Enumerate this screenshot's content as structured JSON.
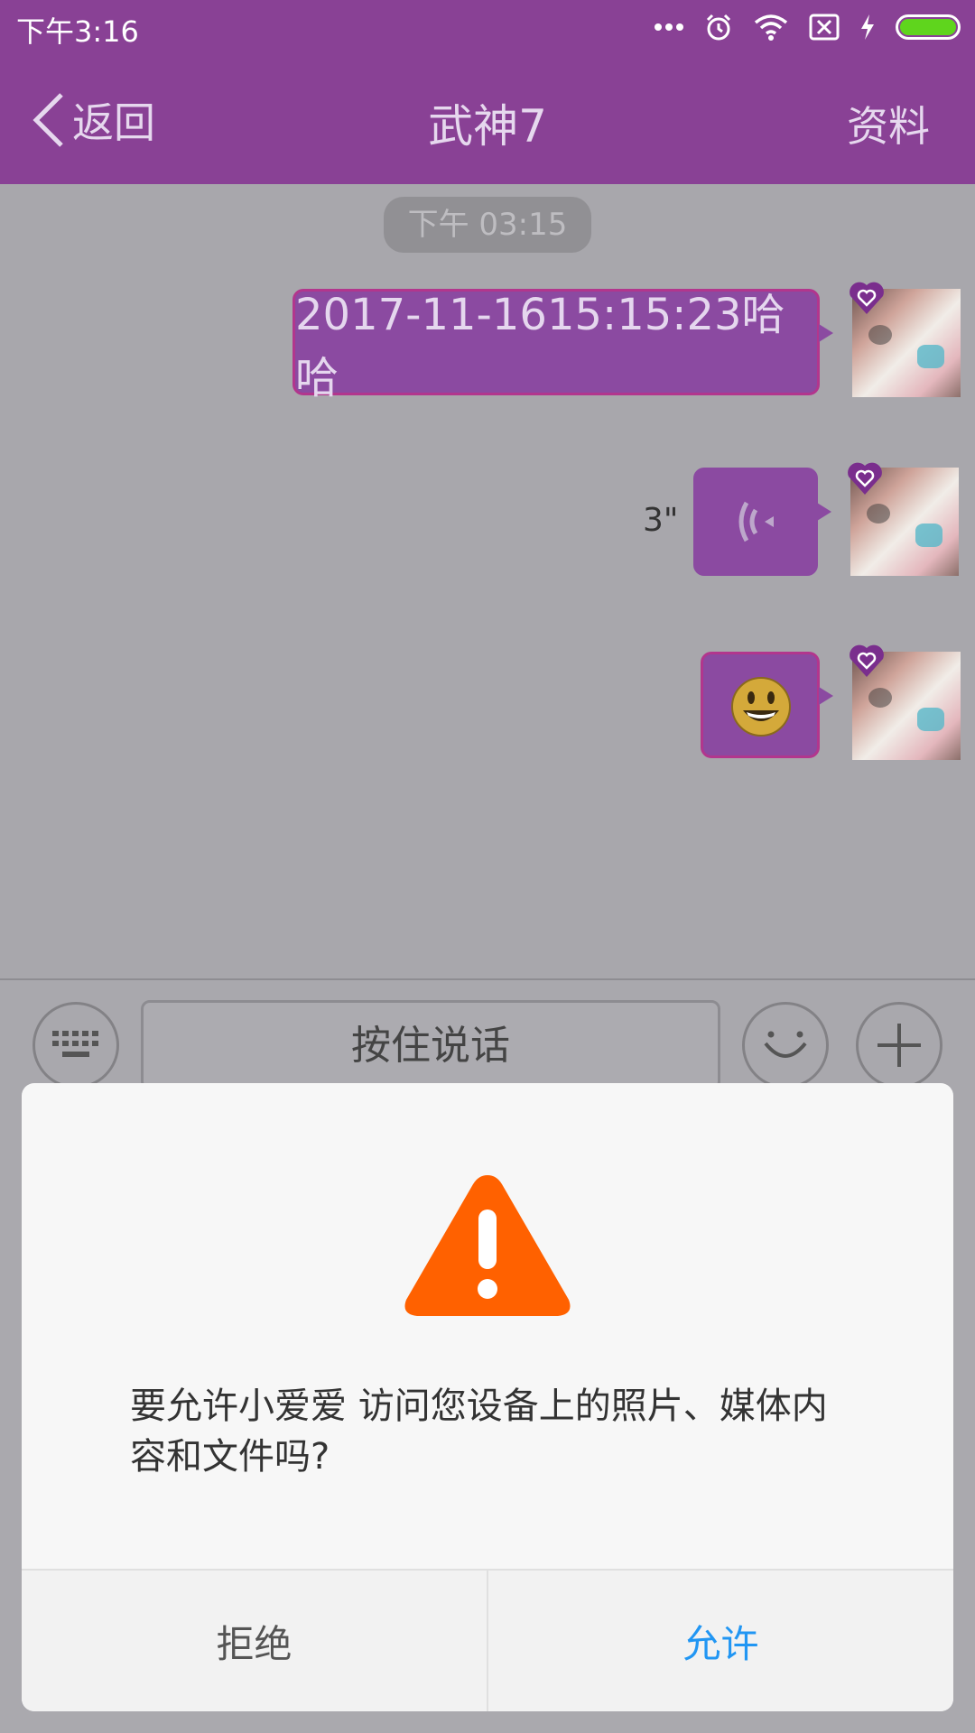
{
  "status_bar": {
    "time": "下午3:16",
    "icons": [
      "more-dots-icon",
      "alarm-icon",
      "wifi-icon",
      "no-sim-icon",
      "charging-icon",
      "battery-icon"
    ],
    "battery_color": "#5fd51d"
  },
  "nav": {
    "back_label": "返回",
    "title": "武神7",
    "profile_label": "资料",
    "background": "#894195"
  },
  "chat": {
    "timestamp": "下午 03:15",
    "messages": [
      {
        "type": "text",
        "text": "2017-11-1615:15:23哈哈",
        "sender": "self"
      },
      {
        "type": "voice",
        "duration": "3\"",
        "sender": "self"
      },
      {
        "type": "emoji",
        "emoji": "smiley-emoji",
        "sender": "self"
      }
    ],
    "bubble_color": "#8b4aa1"
  },
  "input_bar": {
    "hold_to_talk_label": "按住说话",
    "icons": [
      "keyboard-icon",
      "smiley-icon",
      "plus-icon"
    ]
  },
  "dialog": {
    "message": "要允许小爱爱 访问您设备上的照片、媒体内容和文件吗?",
    "deny_label": "拒绝",
    "allow_label": "允许",
    "icon": "warning-icon",
    "icon_color": "#ff6100",
    "allow_color": "#2196f3"
  }
}
